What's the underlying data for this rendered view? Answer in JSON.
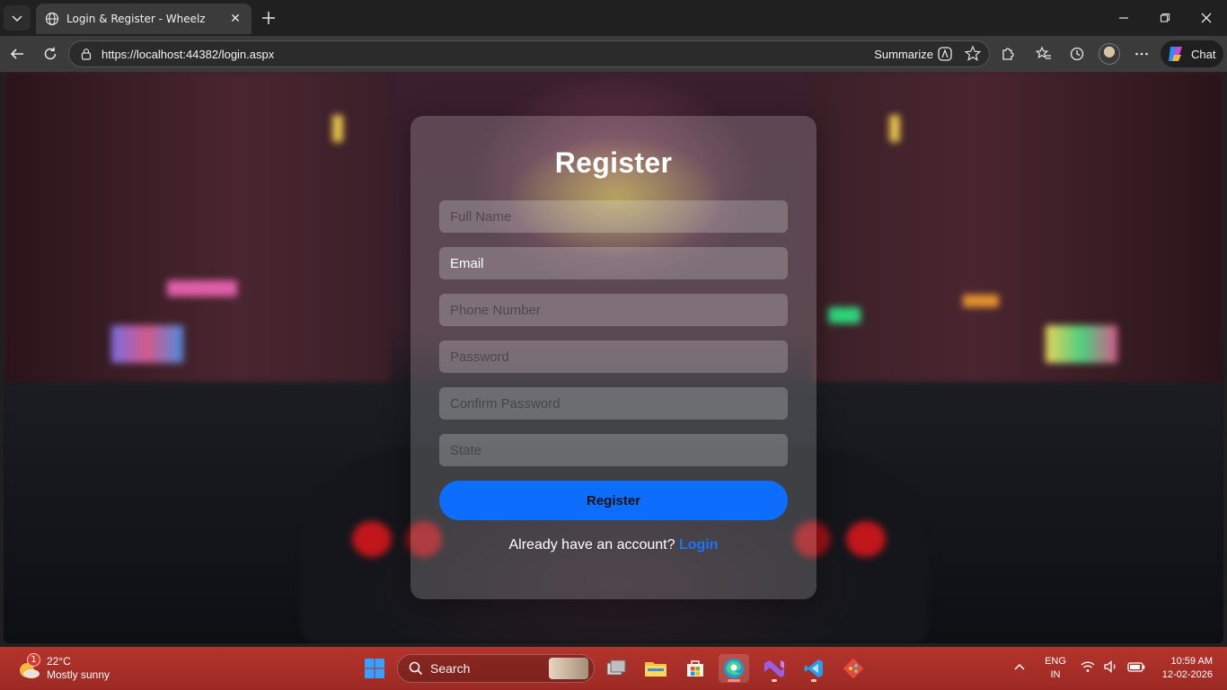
{
  "browser": {
    "tab_title": "Login & Register - Wheelz",
    "url": "https://localhost:44382/login.aspx",
    "summarize_label": "Summarize",
    "chat_label": "Chat"
  },
  "form": {
    "title": "Register",
    "fields": {
      "full_name": {
        "placeholder": "Full Name",
        "value": ""
      },
      "email": {
        "placeholder": "Email",
        "value": "Email"
      },
      "phone": {
        "placeholder": "Phone Number",
        "value": ""
      },
      "password": {
        "placeholder": "Password",
        "value": ""
      },
      "confirm_password": {
        "placeholder": "Confirm Password",
        "value": ""
      },
      "state": {
        "placeholder": "State",
        "value": ""
      }
    },
    "submit_label": "Register",
    "switch_prompt": "Already have an account?",
    "switch_link": "Login"
  },
  "taskbar": {
    "weather_temp": "22°C",
    "weather_condition": "Mostly sunny",
    "weather_badge": "1",
    "search_label": "Search",
    "lang_line1": "ENG",
    "lang_line2": "IN",
    "time": "10:59 AM",
    "date": "12-02-2026",
    "apps": [
      "task-view-icon",
      "file-explorer-icon",
      "microsoft-store-icon",
      "edge-icon",
      "visual-studio-icon",
      "vscode-icon",
      "git-icon"
    ]
  },
  "colors": {
    "accent": "#0d6efd",
    "link": "#1a73ff",
    "taskbar": "#b4342c"
  }
}
